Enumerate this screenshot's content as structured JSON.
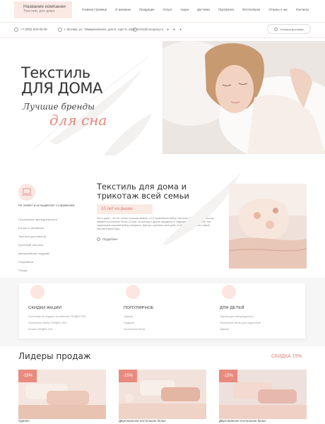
{
  "header": {
    "logo_title": "Название компании",
    "logo_sub": "Текстиль для дома",
    "nav": [
      "Главная страница",
      "О магазине",
      "Продукция",
      "Услуги",
      "Акции",
      "Доставка",
      "Портфолио",
      "Фотогалерея",
      "Отзывы о нас",
      "Контакты"
    ],
    "phone": "+7 (000) 000-00-00",
    "address": "г. Москва, ул. Тимирязевская, дом 5, корп 6, офис 3",
    "email": "info@company.ru",
    "delivery_label": "Условия доставки"
  },
  "hero": {
    "title_line1": "Текстиль",
    "title_line2": "для дома",
    "subtitle1": "Лучшие бренды",
    "subtitle2": "для сна"
  },
  "about": {
    "side_title": "Не линяет и не выцветает со временем",
    "side_links": [
      "Постельные принадлежности",
      "Шторы и занавески",
      "Текстиль для ванной",
      "Кухонный текстиль",
      "Декоративные подушки",
      "Покрывала",
      "Пледы"
    ],
    "title_line1": "Текстиль для дома и",
    "title_line2": "трикотаж всей семьи",
    "years": "10 лет на рынке",
    "text": "Уют в доме – это не только хорошая мебель, но и правильный выбор текстиля. В нашем магазине вы найдёте постельное бельё, шторы, полотенца и другие предметы от ведущих производителей. Мы предлагаем широкий выбор расцветок, фактур и ценовых категорий, чтобы удовлетворить самый взыскательный вкус.",
    "more": "Подробнее"
  },
  "promo": [
    {
      "title": "СКИДКИ АКЦИИ",
      "items": [
        "Полотенце на подарок за комплект СКИДКА 30%",
        "Постельное белье СКИДКА 15%",
        "Шторы СКИДКА 20%"
      ]
    },
    {
      "title": "ПОПУЛЯРНОЕ",
      "items": [
        "Одеяла",
        "Подушки",
        "Постельное белье"
      ]
    },
    {
      "title": "ДЛЯ ДЕТЕЙ",
      "items": [
        "Одеяла для новорожденных",
        "Постельное белье для подростков",
        "Одеяла"
      ]
    }
  ],
  "leaders": {
    "title": "Лидеры продаж",
    "sale_link": "СКИДКА 15%",
    "products": [
      {
        "badge": "-15%",
        "name": "Одеяло"
      },
      {
        "badge": "-15%",
        "name": "Двухспальное постельное белье"
      },
      {
        "badge": "-15%",
        "name": "Двухспальное постельное белье"
      }
    ]
  },
  "colors": {
    "accent": "#e7867a",
    "accent_soft": "#fbe9e4"
  }
}
